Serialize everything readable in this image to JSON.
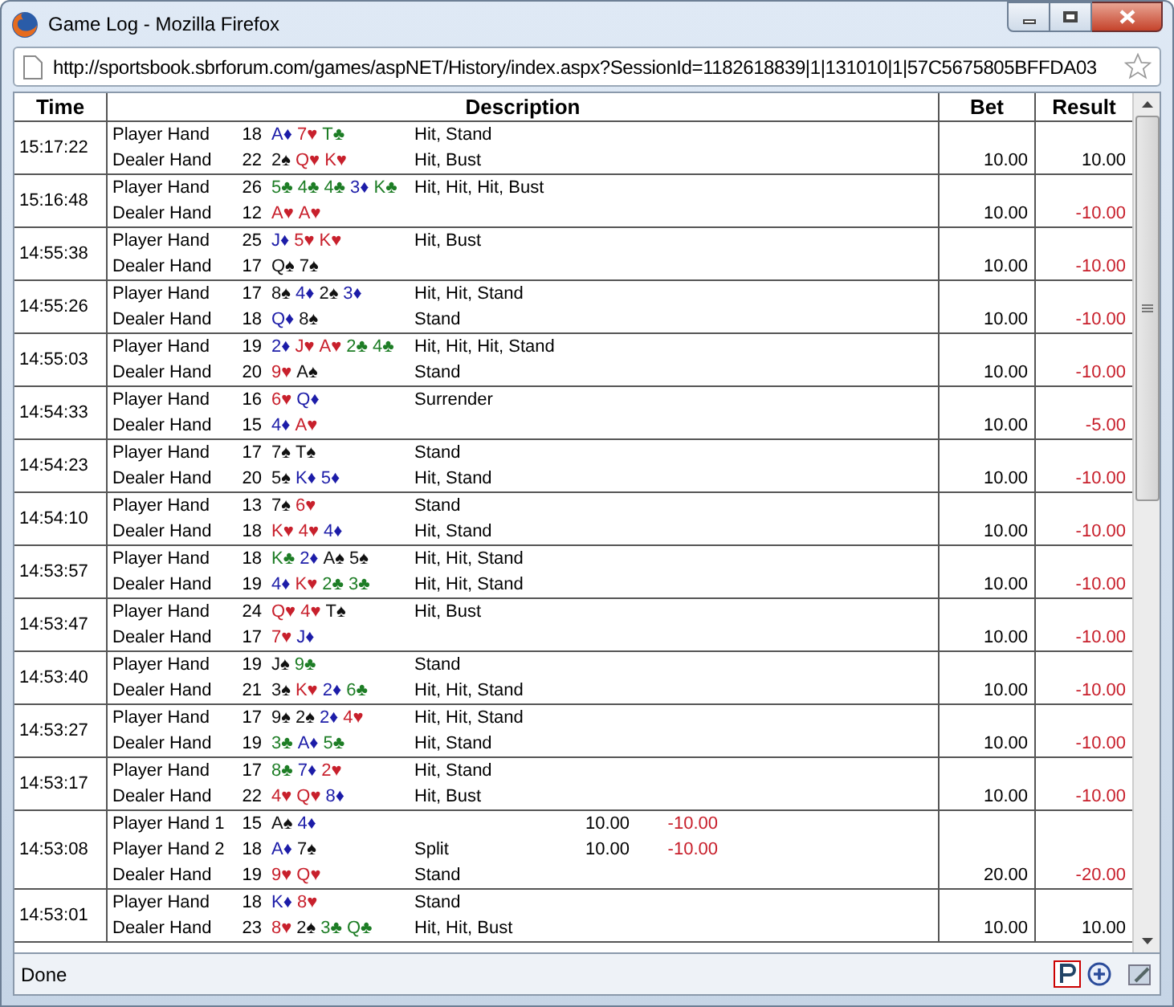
{
  "window": {
    "title": "Game Log - Mozilla Firefox"
  },
  "address_bar": {
    "url": "http://sportsbook.sbrforum.com/games/aspNET/History/index.aspx?SessionId=1182618839|1|131010|1|57C5675805BFFDA03"
  },
  "table": {
    "columns": [
      "Time",
      "Description",
      "Bet",
      "Result"
    ],
    "rows": [
      {
        "time": "15:17:22",
        "bet": "10.00",
        "result": {
          "text": "10.00",
          "kind": "win"
        },
        "hands": [
          {
            "label": "Player Hand",
            "total": "18",
            "cards": [
              {
                "text": "A♦",
                "kind": "diamond"
              },
              {
                "text": "7♥",
                "kind": "heart"
              },
              {
                "text": "T♣",
                "kind": "club"
              }
            ],
            "actions": "Hit, Stand"
          },
          {
            "label": "Dealer Hand",
            "total": "22",
            "cards": [
              {
                "text": "2♠",
                "kind": "spade"
              },
              {
                "text": "Q♥",
                "kind": "heart"
              },
              {
                "text": "K♥",
                "kind": "heart"
              }
            ],
            "actions": "Hit, Bust"
          }
        ]
      },
      {
        "time": "15:16:48",
        "bet": "10.00",
        "result": {
          "text": "-10.00",
          "kind": "loss"
        },
        "hands": [
          {
            "label": "Player Hand",
            "total": "26",
            "cards": [
              {
                "text": "5♣",
                "kind": "club"
              },
              {
                "text": "4♣",
                "kind": "club"
              },
              {
                "text": "4♣",
                "kind": "club"
              },
              {
                "text": "3♦",
                "kind": "diamond"
              },
              {
                "text": "K♣",
                "kind": "club"
              }
            ],
            "actions": "Hit, Hit, Hit, Bust"
          },
          {
            "label": "Dealer Hand",
            "total": "12",
            "cards": [
              {
                "text": "A♥",
                "kind": "heart"
              },
              {
                "text": "A♥",
                "kind": "heart"
              }
            ]
          }
        ]
      },
      {
        "time": "14:55:38",
        "bet": "10.00",
        "result": {
          "text": "-10.00",
          "kind": "loss"
        },
        "hands": [
          {
            "label": "Player Hand",
            "total": "25",
            "cards": [
              {
                "text": "J♦",
                "kind": "diamond"
              },
              {
                "text": "5♥",
                "kind": "heart"
              },
              {
                "text": "K♥",
                "kind": "heart"
              }
            ],
            "actions": "Hit, Bust"
          },
          {
            "label": "Dealer Hand",
            "total": "17",
            "cards": [
              {
                "text": "Q♠",
                "kind": "spade"
              },
              {
                "text": "7♠",
                "kind": "spade"
              }
            ]
          }
        ]
      },
      {
        "time": "14:55:26",
        "bet": "10.00",
        "result": {
          "text": "-10.00",
          "kind": "loss"
        },
        "hands": [
          {
            "label": "Player Hand",
            "total": "17",
            "cards": [
              {
                "text": "8♠",
                "kind": "spade"
              },
              {
                "text": "4♦",
                "kind": "diamond"
              },
              {
                "text": "2♠",
                "kind": "spade"
              },
              {
                "text": "3♦",
                "kind": "diamond"
              }
            ],
            "actions": "Hit, Hit, Stand"
          },
          {
            "label": "Dealer Hand",
            "total": "18",
            "cards": [
              {
                "text": "Q♦",
                "kind": "diamond"
              },
              {
                "text": "8♠",
                "kind": "spade"
              }
            ],
            "actions": "Stand"
          }
        ]
      },
      {
        "time": "14:55:03",
        "bet": "10.00",
        "result": {
          "text": "-10.00",
          "kind": "loss"
        },
        "hands": [
          {
            "label": "Player Hand",
            "total": "19",
            "cards": [
              {
                "text": "2♦",
                "kind": "diamond"
              },
              {
                "text": "J♥",
                "kind": "heart"
              },
              {
                "text": "A♥",
                "kind": "heart"
              },
              {
                "text": "2♣",
                "kind": "club"
              },
              {
                "text": "4♣",
                "kind": "club"
              }
            ],
            "actions": "Hit, Hit, Hit, Stand"
          },
          {
            "label": "Dealer Hand",
            "total": "20",
            "cards": [
              {
                "text": "9♥",
                "kind": "heart"
              },
              {
                "text": "A♠",
                "kind": "spade"
              }
            ],
            "actions": "Stand"
          }
        ]
      },
      {
        "time": "14:54:33",
        "bet": "10.00",
        "result": {
          "text": "-5.00",
          "kind": "loss"
        },
        "hands": [
          {
            "label": "Player Hand",
            "total": "16",
            "cards": [
              {
                "text": "6♥",
                "kind": "heart"
              },
              {
                "text": "Q♦",
                "kind": "diamond"
              }
            ],
            "actions": "Surrender"
          },
          {
            "label": "Dealer Hand",
            "total": "15",
            "cards": [
              {
                "text": "4♦",
                "kind": "diamond"
              },
              {
                "text": "A♥",
                "kind": "heart"
              }
            ]
          }
        ]
      },
      {
        "time": "14:54:23",
        "bet": "10.00",
        "result": {
          "text": "-10.00",
          "kind": "loss"
        },
        "hands": [
          {
            "label": "Player Hand",
            "total": "17",
            "cards": [
              {
                "text": "7♠",
                "kind": "spade"
              },
              {
                "text": "T♠",
                "kind": "spade"
              }
            ],
            "actions": "Stand"
          },
          {
            "label": "Dealer Hand",
            "total": "20",
            "cards": [
              {
                "text": "5♠",
                "kind": "spade"
              },
              {
                "text": "K♦",
                "kind": "diamond"
              },
              {
                "text": "5♦",
                "kind": "diamond"
              }
            ],
            "actions": "Hit, Stand"
          }
        ]
      },
      {
        "time": "14:54:10",
        "bet": "10.00",
        "result": {
          "text": "-10.00",
          "kind": "loss"
        },
        "hands": [
          {
            "label": "Player Hand",
            "total": "13",
            "cards": [
              {
                "text": "7♠",
                "kind": "spade"
              },
              {
                "text": "6♥",
                "kind": "heart"
              }
            ],
            "actions": "Stand"
          },
          {
            "label": "Dealer Hand",
            "total": "18",
            "cards": [
              {
                "text": "K♥",
                "kind": "heart"
              },
              {
                "text": "4♥",
                "kind": "heart"
              },
              {
                "text": "4♦",
                "kind": "diamond"
              }
            ],
            "actions": "Hit, Stand"
          }
        ]
      },
      {
        "time": "14:53:57",
        "bet": "10.00",
        "result": {
          "text": "-10.00",
          "kind": "loss"
        },
        "hands": [
          {
            "label": "Player Hand",
            "total": "18",
            "cards": [
              {
                "text": "K♣",
                "kind": "club"
              },
              {
                "text": "2♦",
                "kind": "diamond"
              },
              {
                "text": "A♠",
                "kind": "spade"
              },
              {
                "text": "5♠",
                "kind": "spade"
              }
            ],
            "actions": "Hit, Hit, Stand"
          },
          {
            "label": "Dealer Hand",
            "total": "19",
            "cards": [
              {
                "text": "4♦",
                "kind": "diamond"
              },
              {
                "text": "K♥",
                "kind": "heart"
              },
              {
                "text": "2♣",
                "kind": "club"
              },
              {
                "text": "3♣",
                "kind": "club"
              }
            ],
            "actions": "Hit, Hit, Stand"
          }
        ]
      },
      {
        "time": "14:53:47",
        "bet": "10.00",
        "result": {
          "text": "-10.00",
          "kind": "loss"
        },
        "hands": [
          {
            "label": "Player Hand",
            "total": "24",
            "cards": [
              {
                "text": "Q♥",
                "kind": "heart"
              },
              {
                "text": "4♥",
                "kind": "heart"
              },
              {
                "text": "T♠",
                "kind": "spade"
              }
            ],
            "actions": "Hit, Bust"
          },
          {
            "label": "Dealer Hand",
            "total": "17",
            "cards": [
              {
                "text": "7♥",
                "kind": "heart"
              },
              {
                "text": "J♦",
                "kind": "diamond"
              }
            ]
          }
        ]
      },
      {
        "time": "14:53:40",
        "bet": "10.00",
        "result": {
          "text": "-10.00",
          "kind": "loss"
        },
        "hands": [
          {
            "label": "Player Hand",
            "total": "19",
            "cards": [
              {
                "text": "J♠",
                "kind": "spade"
              },
              {
                "text": "9♣",
                "kind": "club"
              }
            ],
            "actions": "Stand"
          },
          {
            "label": "Dealer Hand",
            "total": "21",
            "cards": [
              {
                "text": "3♠",
                "kind": "spade"
              },
              {
                "text": "K♥",
                "kind": "heart"
              },
              {
                "text": "2♦",
                "kind": "diamond"
              },
              {
                "text": "6♣",
                "kind": "club"
              }
            ],
            "actions": "Hit, Hit, Stand"
          }
        ]
      },
      {
        "time": "14:53:27",
        "bet": "10.00",
        "result": {
          "text": "-10.00",
          "kind": "loss"
        },
        "hands": [
          {
            "label": "Player Hand",
            "total": "17",
            "cards": [
              {
                "text": "9♠",
                "kind": "spade"
              },
              {
                "text": "2♠",
                "kind": "spade"
              },
              {
                "text": "2♦",
                "kind": "diamond"
              },
              {
                "text": "4♥",
                "kind": "heart"
              }
            ],
            "actions": "Hit, Hit, Stand"
          },
          {
            "label": "Dealer Hand",
            "total": "19",
            "cards": [
              {
                "text": "3♣",
                "kind": "club"
              },
              {
                "text": "A♦",
                "kind": "diamond"
              },
              {
                "text": "5♣",
                "kind": "club"
              }
            ],
            "actions": "Hit, Stand"
          }
        ]
      },
      {
        "time": "14:53:17",
        "bet": "10.00",
        "result": {
          "text": "-10.00",
          "kind": "loss"
        },
        "hands": [
          {
            "label": "Player Hand",
            "total": "17",
            "cards": [
              {
                "text": "8♣",
                "kind": "club"
              },
              {
                "text": "7♦",
                "kind": "diamond"
              },
              {
                "text": "2♥",
                "kind": "heart"
              }
            ],
            "actions": "Hit, Stand"
          },
          {
            "label": "Dealer Hand",
            "total": "22",
            "cards": [
              {
                "text": "4♥",
                "kind": "heart"
              },
              {
                "text": "Q♥",
                "kind": "heart"
              },
              {
                "text": "8♦",
                "kind": "diamond"
              }
            ],
            "actions": "Hit, Bust"
          }
        ]
      },
      {
        "time": "14:53:08",
        "bet": "20.00",
        "result": {
          "text": "-20.00",
          "kind": "loss"
        },
        "hands": [
          {
            "label": "Player Hand 1",
            "total": "15",
            "cards": [
              {
                "text": "A♠",
                "kind": "spade"
              },
              {
                "text": "4♦",
                "kind": "diamond"
              }
            ],
            "hand_bet": "10.00",
            "hand_result": {
              "text": "-10.00",
              "kind": "loss"
            }
          },
          {
            "label": "Player Hand 2",
            "total": "18",
            "cards": [
              {
                "text": "A♦",
                "kind": "diamond"
              },
              {
                "text": "7♠",
                "kind": "spade"
              }
            ],
            "actions": "Split",
            "hand_bet": "10.00",
            "hand_result": {
              "text": "-10.00",
              "kind": "loss"
            }
          },
          {
            "label": "Dealer Hand",
            "total": "19",
            "cards": [
              {
                "text": "9♥",
                "kind": "heart"
              },
              {
                "text": "Q♥",
                "kind": "heart"
              }
            ],
            "actions": "Stand"
          }
        ]
      },
      {
        "time": "14:53:01",
        "bet": "10.00",
        "result": {
          "text": "10.00",
          "kind": "win"
        },
        "hands": [
          {
            "label": "Player Hand",
            "total": "18",
            "cards": [
              {
                "text": "K♦",
                "kind": "diamond"
              },
              {
                "text": "8♥",
                "kind": "heart"
              }
            ],
            "actions": "Stand"
          },
          {
            "label": "Dealer Hand",
            "total": "23",
            "cards": [
              {
                "text": "8♥",
                "kind": "heart"
              },
              {
                "text": "2♠",
                "kind": "spade"
              },
              {
                "text": "3♣",
                "kind": "club"
              },
              {
                "text": "Q♣",
                "kind": "club"
              }
            ],
            "actions": "Hit, Hit, Bust"
          }
        ]
      }
    ]
  },
  "status_bar": {
    "text": "Done"
  }
}
